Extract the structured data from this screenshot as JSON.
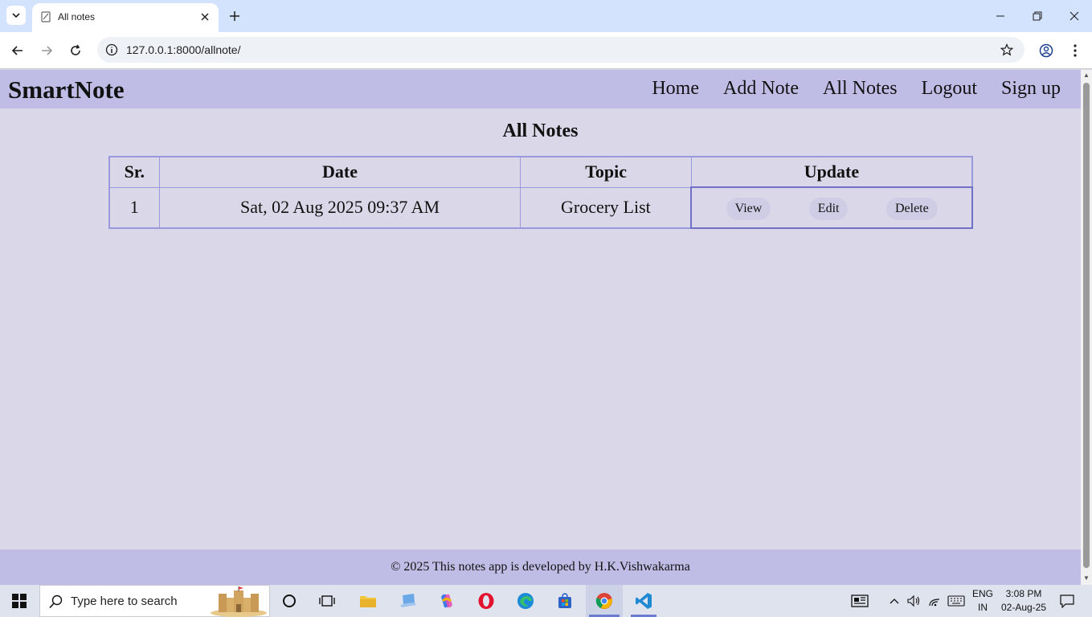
{
  "browser": {
    "tab_title": "All notes",
    "url": "127.0.0.1:8000/allnote/"
  },
  "app": {
    "brand": "SmartNote",
    "nav": [
      {
        "label": "Home"
      },
      {
        "label": "Add Note"
      },
      {
        "label": "All Notes"
      },
      {
        "label": "Logout"
      },
      {
        "label": "Sign up"
      }
    ],
    "heading": "All Notes",
    "table": {
      "headers": [
        "Sr.",
        "Date",
        "Topic",
        "Update"
      ],
      "rows": [
        {
          "sr": "1",
          "date": "Sat, 02 Aug 2025 09:37 AM",
          "topic": "Grocery List"
        }
      ],
      "actions": [
        "View",
        "Edit",
        "Delete"
      ]
    },
    "footer": "© 2025 This notes app is developed by H.K.Vishwakarma"
  },
  "taskbar": {
    "search_placeholder": "Type here to search",
    "lang_line1": "ENG",
    "lang_line2": "IN",
    "time": "3:08 PM",
    "date": "02-Aug-25"
  },
  "colors": {
    "navbar": "#bfbde6",
    "page_bg": "#dad8e8",
    "table_border": "#9999dd"
  }
}
